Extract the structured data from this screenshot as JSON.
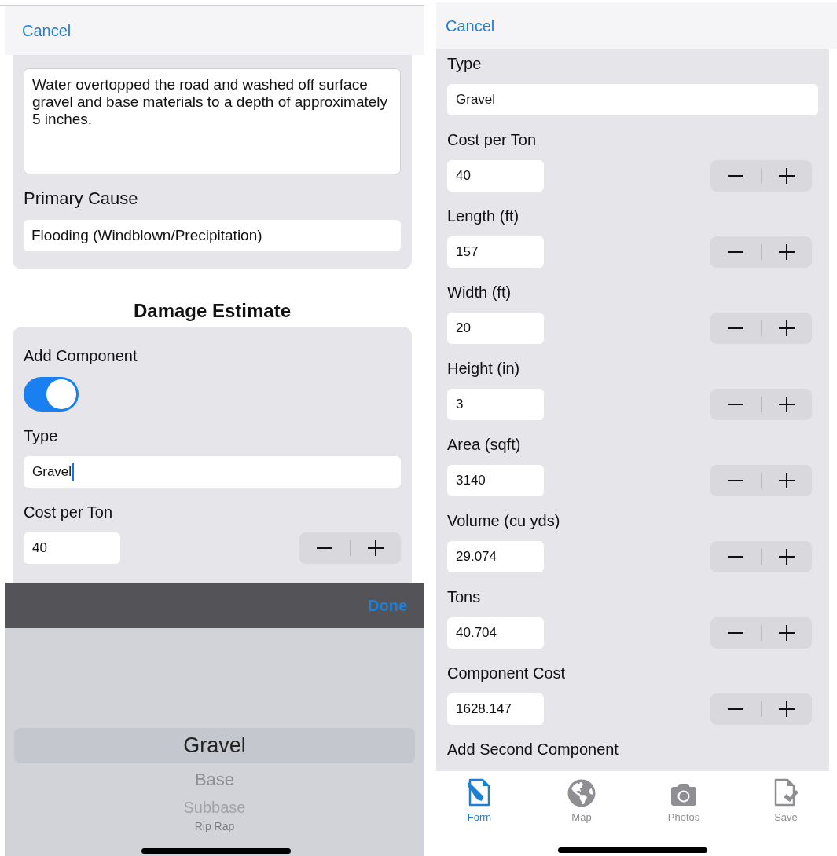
{
  "left_screen": {
    "nav": {
      "cancel": "Cancel"
    },
    "description": {
      "text": "Water overtopped the road and washed off surface gravel and base materials to a depth of approximately 5 inches."
    },
    "primary_cause": {
      "label": "Primary Cause",
      "value": "Flooding (Windblown/Precipitation)"
    },
    "section_title": "Damage Estimate",
    "fields": [
      {
        "kind": "toggle",
        "label": "Add Component",
        "on": true
      },
      {
        "kind": "text",
        "label": "Type",
        "value": "Gravel",
        "focused": true
      },
      {
        "kind": "stepper",
        "label": "Cost per Ton",
        "value": "40"
      }
    ],
    "picker": {
      "done": "Done",
      "options": [
        {
          "label": "Gravel",
          "selected": true
        },
        {
          "label": "Base",
          "selected": false
        },
        {
          "label": "Subbase",
          "selected": false
        },
        {
          "label": "Rip Rap",
          "selected": false
        }
      ]
    }
  },
  "right_screen": {
    "nav": {
      "cancel": "Cancel"
    },
    "fields": [
      {
        "kind": "text",
        "label": "Type",
        "value": "Gravel"
      },
      {
        "kind": "stepper",
        "label": "Cost per Ton",
        "value": "40"
      },
      {
        "kind": "stepper",
        "label": "Length (ft)",
        "value": "157"
      },
      {
        "kind": "stepper",
        "label": "Width (ft)",
        "value": "20"
      },
      {
        "kind": "stepper",
        "label": "Height (in)",
        "value": "3"
      },
      {
        "kind": "stepper",
        "label": "Area (sqft)",
        "value": "3140"
      },
      {
        "kind": "stepper",
        "label": "Volume (cu yds)",
        "value": "29.074"
      },
      {
        "kind": "stepper",
        "label": "Tons",
        "value": "40.704"
      },
      {
        "kind": "stepper",
        "label": "Component Cost",
        "value": "1628.147"
      }
    ],
    "second_component_label": "Add Second Component",
    "tab_bar": [
      {
        "label": "Form",
        "selected": true
      },
      {
        "label": "Map",
        "selected": false
      },
      {
        "label": "Photos",
        "selected": false
      },
      {
        "label": "Save",
        "selected": false
      }
    ]
  }
}
